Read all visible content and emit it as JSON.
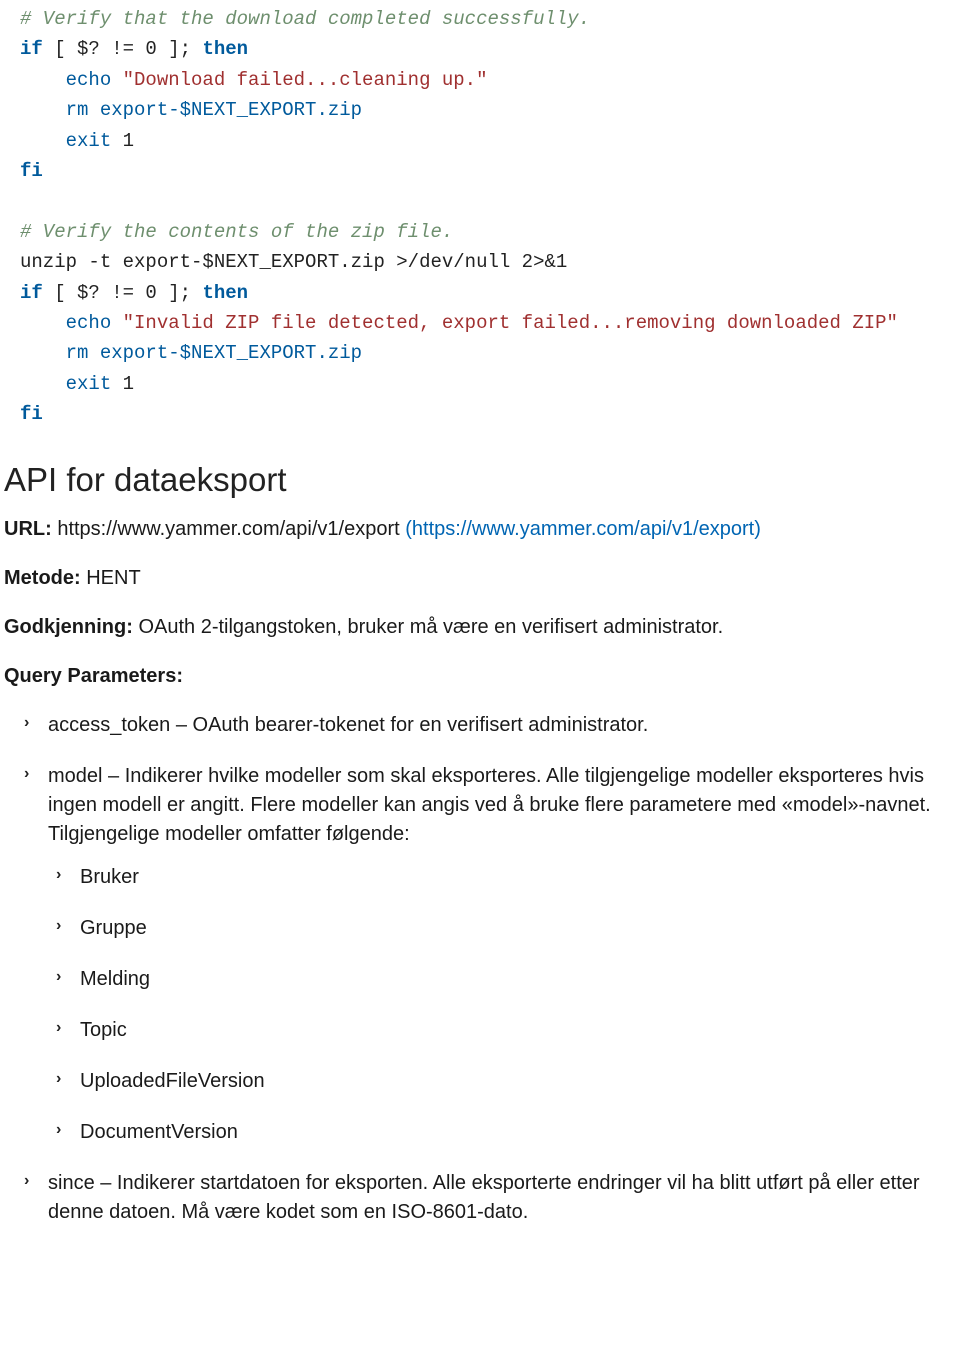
{
  "code": {
    "line1_comment": "# Verify that the download completed successfully.",
    "line2_if": "if",
    "line2_cond": " [ $? != 0 ]; ",
    "line2_then": "then",
    "line3_indent": "    ",
    "line3_echo": "echo",
    "line3_str": " \"Download failed...cleaning up.\"",
    "line4_indent": "    ",
    "line4_rm": "rm",
    "line4_file": " export-$NEXT_EXPORT.zip",
    "line5_indent": "    ",
    "line5_exit": "exit",
    "line5_code": " 1",
    "line6_fi": "fi",
    "blank": "",
    "line8_comment": "# Verify the contents of the zip file.",
    "line9_cmd": "unzip -t export-$NEXT_EXPORT.zip >/dev/null 2>&1",
    "line10_if": "if",
    "line10_cond": " [ $? != 0 ]; ",
    "line10_then": "then",
    "line11_indent": "    ",
    "line11_echo": "echo",
    "line11_str": " \"Invalid ZIP file detected, export failed...removing downloaded ZIP\"",
    "line12_indent": "    ",
    "line12_rm": "rm",
    "line12_file": " export-$NEXT_EXPORT.zip",
    "line13_indent": "    ",
    "line13_exit": "exit",
    "line13_code": " 1",
    "line14_fi": "fi"
  },
  "section_title": "API for dataeksport",
  "url_label": "URL:",
  "url_text": " https://www.yammer.com/api/v1/export ",
  "url_link": "(https://www.yammer.com/api/v1/export)",
  "method_label": "Metode:",
  "method_value": " HENT",
  "auth_label": "Godkjenning:",
  "auth_value": " OAuth 2-tilgangstoken, bruker må være en verifisert administrator.",
  "qp_label": "Query Parameters:",
  "params": {
    "p0": "access_token – OAuth bearer-tokenet for en verifisert administrator.",
    "p1": "model – Indikerer hvilke modeller som skal eksporteres. Alle tilgjengelige modeller eksporteres hvis ingen modell er angitt. Flere modeller kan angis ved å bruke flere parametere med «model»-navnet. Tilgjengelige modeller omfatter følgende:",
    "models": {
      "m0": "Bruker",
      "m1": "Gruppe",
      "m2": "Melding",
      "m3": "Topic",
      "m4": "UploadedFileVersion",
      "m5": "DocumentVersion"
    },
    "p2": "since – Indikerer startdatoen for eksporten. Alle eksporterte endringer vil ha blitt utført på eller etter denne datoen. Må være kodet som en ISO-8601-dato."
  }
}
